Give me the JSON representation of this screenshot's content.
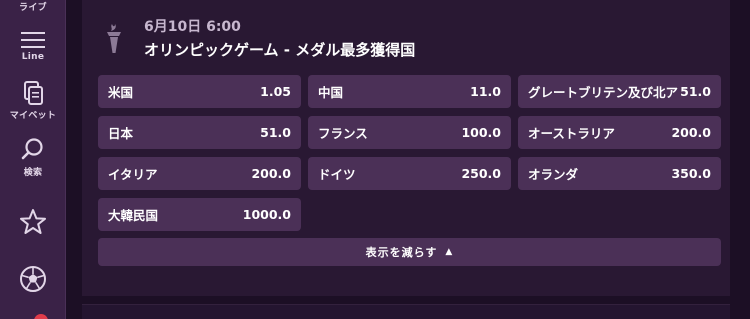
{
  "sidebar": {
    "items": [
      {
        "label": "ライブ",
        "icon": "live-icon"
      },
      {
        "label": "Line",
        "icon": "menu-lines-icon"
      },
      {
        "label": "マイベット",
        "icon": "mybets-icon"
      },
      {
        "label": "検索",
        "icon": "search-icon"
      },
      {
        "label": "",
        "icon": "star-icon"
      },
      {
        "label": "",
        "icon": "soccer-ball-icon"
      }
    ]
  },
  "event": {
    "date": "6月10日 6:00",
    "title": "オリンピックゲーム - メダル最多獲得国",
    "icon": "olympic-torch-icon"
  },
  "odds": [
    {
      "name": "米国",
      "value": "1.05"
    },
    {
      "name": "中国",
      "value": "11.0"
    },
    {
      "name": "グレートブリテン及び北アイルランド",
      "value": "51.0"
    },
    {
      "name": "日本",
      "value": "51.0"
    },
    {
      "name": "フランス",
      "value": "100.0"
    },
    {
      "name": "オーストラリア",
      "value": "200.0"
    },
    {
      "name": "イタリア",
      "value": "200.0"
    },
    {
      "name": "ドイツ",
      "value": "250.0"
    },
    {
      "name": "オランダ",
      "value": "350.0"
    },
    {
      "name": "大韓民国",
      "value": "1000.0"
    }
  ],
  "show_less_label": "表示を減らす",
  "colors": {
    "background": "#1c0f25",
    "sidebar": "#3a2247",
    "card": "#291833",
    "button": "#4b3057",
    "badge": "#e03c4a"
  }
}
